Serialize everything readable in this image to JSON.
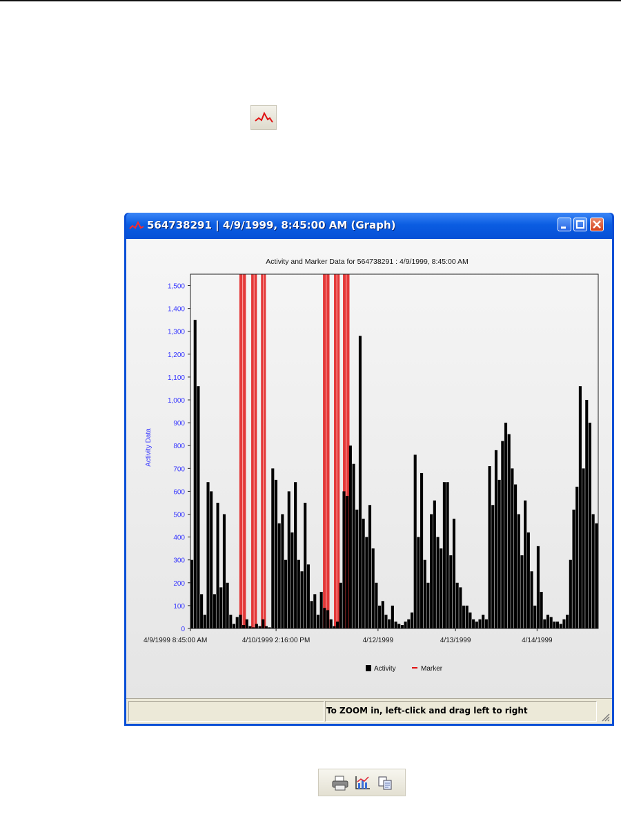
{
  "window": {
    "title": "564738291 | 4/9/1999, 8:45:00 AM (Graph)"
  },
  "status": {
    "hint": "To ZOOM in, left-click and drag left to right"
  },
  "icons": [
    "graph-icon",
    "minimize-icon",
    "maximize-icon",
    "close-icon",
    "print-icon",
    "chart-options-icon",
    "copy-icon",
    "resize-grip-icon"
  ],
  "colors": {
    "activity": "#000000",
    "marker": "#e01010",
    "axis_label": "#3333ff",
    "titlebar": "#0b5de2"
  },
  "chart_data": {
    "type": "bar",
    "title": "Activity and Marker Data for 564738291 : 4/9/1999, 8:45:00 AM",
    "ylabel": "Activity Data",
    "xlabel": "",
    "ylim": [
      0,
      1550
    ],
    "yticks": [
      "0",
      "100",
      "200",
      "300",
      "400",
      "500",
      "600",
      "700",
      "800",
      "900",
      "1,000",
      "1,100",
      "1,200",
      "1,300",
      "1,400",
      "1,500"
    ],
    "xticks": [
      "4/9/1999 8:45:00 AM",
      "4/10/1999 2:16:00 PM",
      "4/12/1999",
      "4/13/1999",
      "4/14/1999"
    ],
    "grid": false,
    "legend_position": "bottom-center",
    "series": [
      {
        "name": "Activity",
        "type": "bar",
        "color": "#000000",
        "values": [
          300,
          1350,
          1060,
          150,
          60,
          640,
          600,
          150,
          550,
          180,
          500,
          200,
          60,
          20,
          50,
          60,
          15,
          40,
          10,
          5,
          20,
          10,
          40,
          10,
          5,
          700,
          650,
          460,
          500,
          300,
          600,
          420,
          640,
          300,
          250,
          550,
          280,
          120,
          150,
          60,
          160,
          90,
          80,
          40,
          10,
          30,
          200,
          600,
          580,
          800,
          720,
          520,
          1280,
          480,
          400,
          540,
          350,
          200,
          100,
          120,
          60,
          40,
          100,
          30,
          20,
          15,
          30,
          40,
          70,
          760,
          400,
          680,
          300,
          200,
          500,
          560,
          400,
          350,
          640,
          640,
          320,
          480,
          200,
          180,
          100,
          100,
          70,
          40,
          30,
          40,
          60,
          40,
          710,
          540,
          780,
          650,
          820,
          900,
          850,
          700,
          630,
          500,
          320,
          560,
          420,
          250,
          100,
          360,
          160,
          40,
          60,
          50,
          30,
          30,
          20,
          40,
          60,
          300,
          520,
          620,
          1060,
          700,
          1000,
          900,
          500,
          460
        ]
      },
      {
        "name": "Marker",
        "type": "band",
        "color": "#e01010",
        "bands": [
          [
            0.12,
            0.136
          ],
          [
            0.149,
            0.163
          ],
          [
            0.173,
            0.185
          ],
          [
            0.325,
            0.341
          ],
          [
            0.352,
            0.366
          ],
          [
            0.374,
            0.39
          ]
        ]
      }
    ]
  }
}
